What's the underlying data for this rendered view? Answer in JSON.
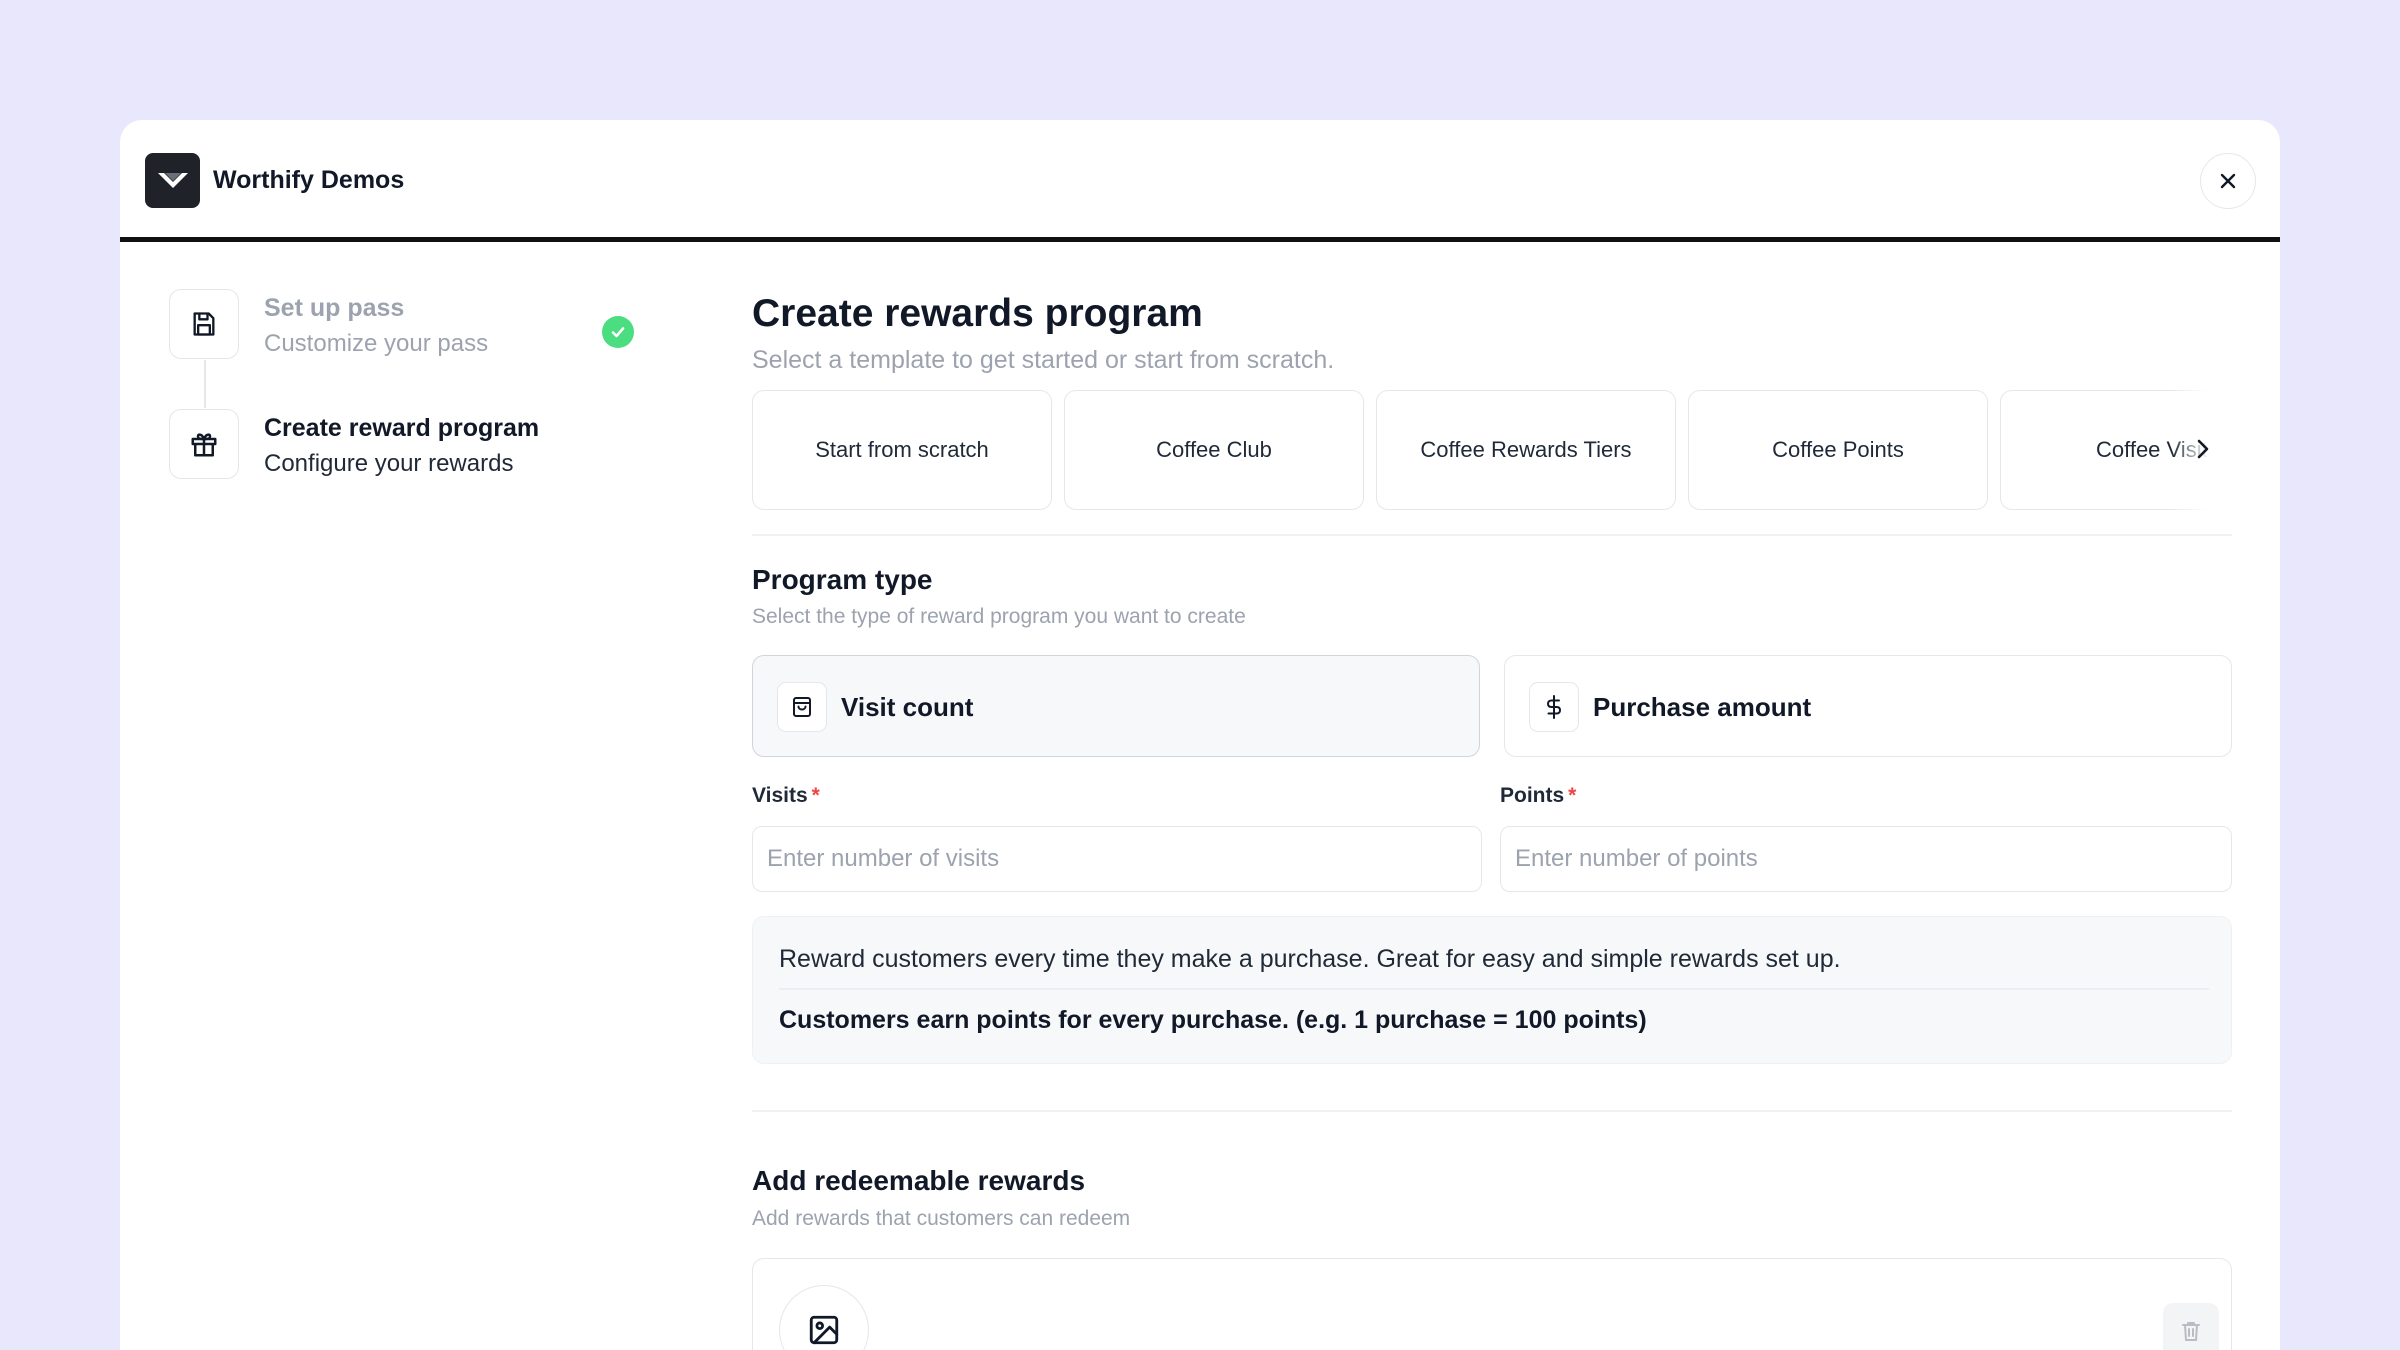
{
  "app": {
    "brand": "Worthify Demos"
  },
  "colors": {
    "background": "#e9e7fc",
    "check": "#4ade80",
    "required": "#ef4444",
    "text": "#111827",
    "muted": "#9ca3af"
  },
  "icons": {
    "logo": "worthify-logo-icon",
    "close": "close-icon",
    "step1": "save-icon",
    "step2": "gift-icon",
    "done": "check-circle-icon",
    "carousel_next": "chevron-right-icon",
    "visit": "shopping-bag-icon",
    "purchase": "dollar-icon",
    "image": "image-icon",
    "delete": "trash-icon"
  },
  "steps": [
    {
      "title": "Set up pass",
      "subtitle": "Customize your pass",
      "completed": true
    },
    {
      "title": "Create reward program",
      "subtitle": "Configure your rewards",
      "completed": false
    }
  ],
  "main": {
    "title": "Create rewards program",
    "subtitle": "Select a template to get started or start from scratch.",
    "templates": [
      "Start from scratch",
      "Coffee Club",
      "Coffee Rewards Tiers",
      "Coffee Points",
      "Coffee Visits"
    ]
  },
  "program_type": {
    "title": "Program type",
    "subtitle": "Select the type of reward program you want to create",
    "options": [
      {
        "label": "Visit count",
        "selected": true
      },
      {
        "label": "Purchase amount",
        "selected": false
      }
    ]
  },
  "fields": {
    "visits": {
      "label": "Visits",
      "required_mark": "*",
      "placeholder": "Enter number of visits",
      "value": ""
    },
    "points": {
      "label": "Points",
      "required_mark": "*",
      "placeholder": "Enter number of points",
      "value": ""
    }
  },
  "info": {
    "description": "Reward customers every time they make a purchase. Great for easy and simple rewards set up.",
    "example": "Customers earn points for every purchase. (e.g. 1 purchase = 100 points)"
  },
  "rewards": {
    "title": "Add redeemable rewards",
    "subtitle": "Add rewards that customers can redeem"
  }
}
